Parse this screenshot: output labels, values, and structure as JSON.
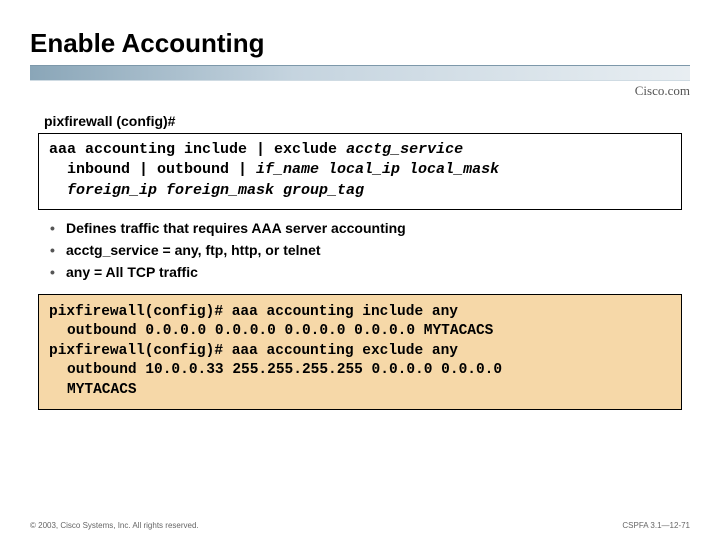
{
  "title": "Enable Accounting",
  "brand": "Cisco.com",
  "prompt": "pixfirewall (config)#",
  "syntax": {
    "line1a": "aaa accounting include | exclude ",
    "line1b": "acctg_service",
    "line2a": "inbound | outbound | ",
    "line2b": "if_name local_ip local_mask",
    "line3": "foreign_ip foreign_mask group_tag"
  },
  "bullets": [
    "Defines traffic that requires AAA server accounting",
    "acctg_service = any, ftp, http, or telnet",
    "any = All TCP traffic"
  ],
  "example": {
    "l1": "pixfirewall(config)# aaa accounting include any",
    "l2": "outbound 0.0.0.0 0.0.0.0 0.0.0.0 0.0.0.0 MYTACACS",
    "l3": "pixfirewall(config)# aaa accounting exclude any",
    "l4": "outbound 10.0.0.33 255.255.255.255 0.0.0.0 0.0.0.0",
    "l5": "MYTACACS"
  },
  "footer": {
    "left": "© 2003, Cisco Systems, Inc. All rights reserved.",
    "right": "CSPFA 3.1—12-71"
  }
}
